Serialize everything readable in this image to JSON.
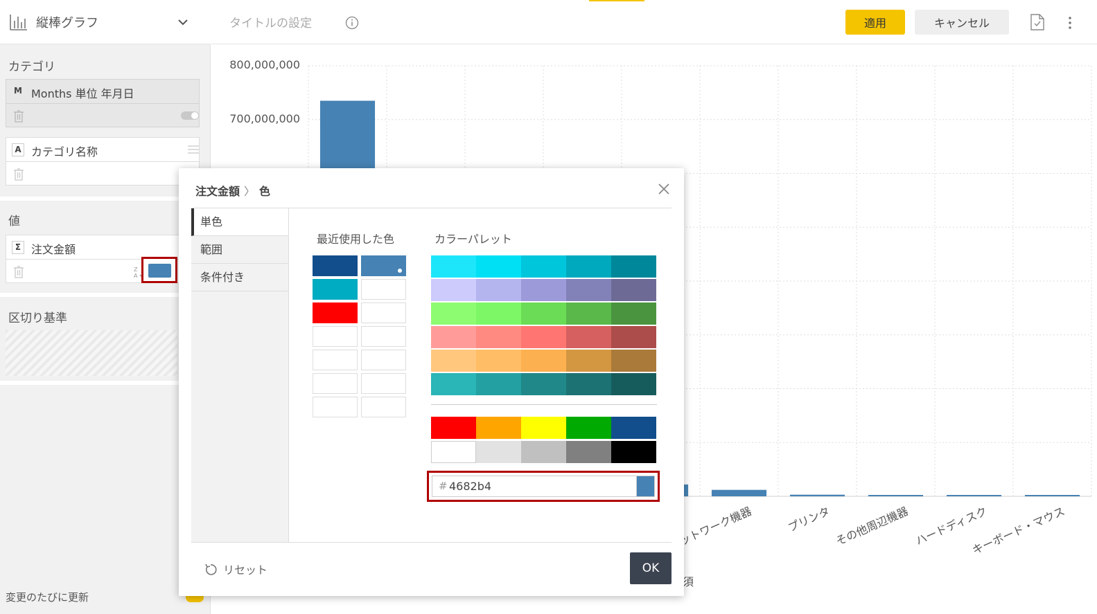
{
  "left_panel": {
    "chart_type_label": "縦棒グラフ",
    "category_title": "カテゴリ",
    "category_fields": [
      {
        "badge": "M",
        "name": "Months 単位 年月日"
      },
      {
        "badge": "A",
        "name": "カテゴリ名称"
      }
    ],
    "value_title": "値",
    "value_field": {
      "badge": "Σ",
      "name": "注文金額",
      "color": "#4682b4"
    },
    "split_title": "区切り基準",
    "auto_update_label": "変更のたびに更新"
  },
  "topbar": {
    "title_placeholder": "タイトルの設定",
    "apply_label": "適用",
    "cancel_label": "キャンセル"
  },
  "chart_data": {
    "type": "bar",
    "y_ticks": [
      "800,000,000",
      "700,000,000"
    ],
    "ylim": [
      0,
      800000000
    ],
    "bar_color": "#4682b4",
    "categories": [
      "",
      "",
      "",
      "",
      "ー",
      "ネットワーク機器",
      "プリンタ",
      "その他周辺機器",
      "ハードディスク",
      "キーボード・マウス"
    ],
    "values": [
      735000000,
      null,
      null,
      null,
      22000000,
      12000000,
      3000000,
      2000000,
      1500000,
      1000000
    ],
    "partial_label": "須"
  },
  "dialog": {
    "breadcrumb_parent": "注文金額",
    "breadcrumb_child": "色",
    "tabs": [
      "単色",
      "範囲",
      "条件付き"
    ],
    "recent_title": "最近使用した色",
    "palette_title": "カラーパレット",
    "recent_colors": [
      "#124e8c",
      "#4682b4",
      "#00acc1",
      "#ffffff",
      "#ff0000",
      "#ffffff",
      "#ffffff",
      "#ffffff",
      "#ffffff",
      "#ffffff",
      "#ffffff",
      "#ffffff",
      "#ffffff",
      "#ffffff"
    ],
    "palette_rows": [
      [
        "#1ee6fa",
        "#00e0f5",
        "#00c6dc",
        "#00a9bd",
        "#00889a"
      ],
      [
        "#cccbfb",
        "#b4b4ef",
        "#9c9ad9",
        "#8382b8",
        "#6d6b96"
      ],
      [
        "#8efc70",
        "#7ef767",
        "#6bdc55",
        "#5ab84b",
        "#4a943f"
      ],
      [
        "#ff9c9a",
        "#ff8a82",
        "#ff7571",
        "#d5605f",
        "#ac4d4b"
      ],
      [
        "#ffc77e",
        "#ffbd66",
        "#fcb04f",
        "#d39742",
        "#aa7a3a"
      ],
      [
        "#2ab5b6",
        "#23a1a2",
        "#208888",
        "#1c7273",
        "#175c5d"
      ]
    ],
    "basic_rows": [
      [
        "#ff0000",
        "#ffa500",
        "#ffff00",
        "#00aa00",
        "#124e8c"
      ],
      [
        "#ffffff",
        "#e2e2e2",
        "#c0c0c0",
        "#808080",
        "#000000"
      ]
    ],
    "hex_value": "4682b4",
    "hex_prefix": "#",
    "selected_color": "#4682b4",
    "reset_label": "リセット",
    "ok_label": "OK"
  }
}
